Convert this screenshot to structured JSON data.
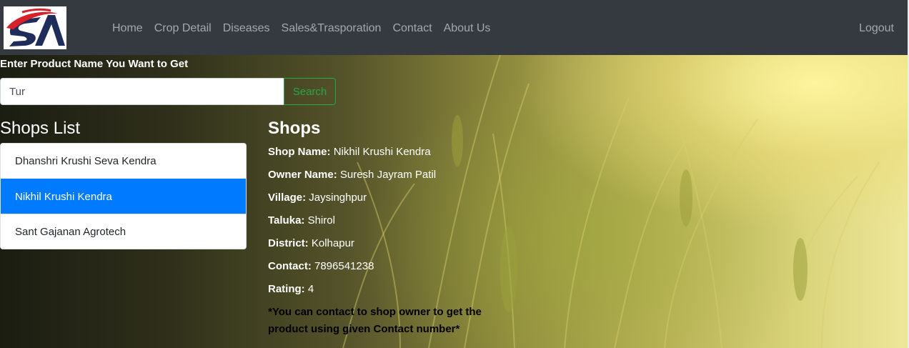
{
  "navbar": {
    "logo_alt": "SA",
    "links": [
      "Home",
      "Crop Detail",
      "Diseases",
      "Sales&Trasporation",
      "Contact",
      "About Us"
    ],
    "logout_label": "Logout"
  },
  "search": {
    "label": "Enter Product Name You Want to Get",
    "value": "Tur",
    "button_label": "Search"
  },
  "shops_list": {
    "heading": "Shops List",
    "items": [
      "Dhanshri Krushi Seva Kendra",
      "Nikhil Krushi Kendra",
      "Sant Gajanan Agrotech"
    ],
    "active_index": 1
  },
  "shop_detail": {
    "heading": "Shops",
    "fields": [
      {
        "label": "Shop Name:",
        "value": "Nikhil Krushi Kendra"
      },
      {
        "label": "Owner Name:",
        "value": "Suresh Jayram Patil"
      },
      {
        "label": "Village:",
        "value": "Jaysinghpur"
      },
      {
        "label": "Taluka:",
        "value": "Shirol"
      },
      {
        "label": "District:",
        "value": "Kolhapur"
      },
      {
        "label": "Contact:",
        "value": "7896541238"
      },
      {
        "label": "Rating:",
        "value": "4"
      }
    ],
    "note": "*You can contact to shop owner to get the product using given Contact number*"
  },
  "colors": {
    "navbar": "#343a40",
    "active_item": "#007bff",
    "search_button": "#28a745"
  }
}
